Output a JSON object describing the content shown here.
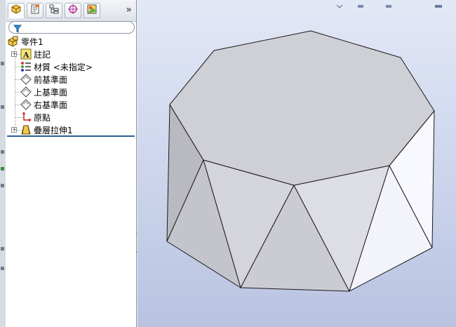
{
  "feature_manager": {
    "tabs": [
      {
        "icon": "feature-tree-icon"
      },
      {
        "icon": "property-manager-icon"
      },
      {
        "icon": "configuration-manager-icon"
      },
      {
        "icon": "dimxpert-icon"
      },
      {
        "icon": "display-manager-icon"
      }
    ],
    "more_tabs": "»",
    "filter": {
      "icon": "filter-icon",
      "value": ""
    },
    "tree": [
      {
        "label": "零件1",
        "icon": "part-icon",
        "expandable": false
      },
      {
        "label": "註記",
        "icon": "annotations-icon",
        "expandable": true
      },
      {
        "label": "材質 <未指定>",
        "icon": "material-icon",
        "expandable": false
      },
      {
        "label": "前基準面",
        "icon": "plane-icon",
        "expandable": false
      },
      {
        "label": "上基準面",
        "icon": "plane-icon",
        "expandable": false
      },
      {
        "label": "右基準面",
        "icon": "plane-icon",
        "expandable": false
      },
      {
        "label": "原點",
        "icon": "origin-icon",
        "expandable": false
      },
      {
        "label": "疊層拉伸1",
        "icon": "loft-feature-icon",
        "expandable": true
      }
    ]
  },
  "graphics_area": {
    "model": "octagonal-antiprism-solid",
    "colors": {
      "edge": "#1a1a1a",
      "top_face": "#cfcfd6",
      "light_face": "#f3f3fb",
      "dark_face": "#b9b9c1"
    }
  }
}
